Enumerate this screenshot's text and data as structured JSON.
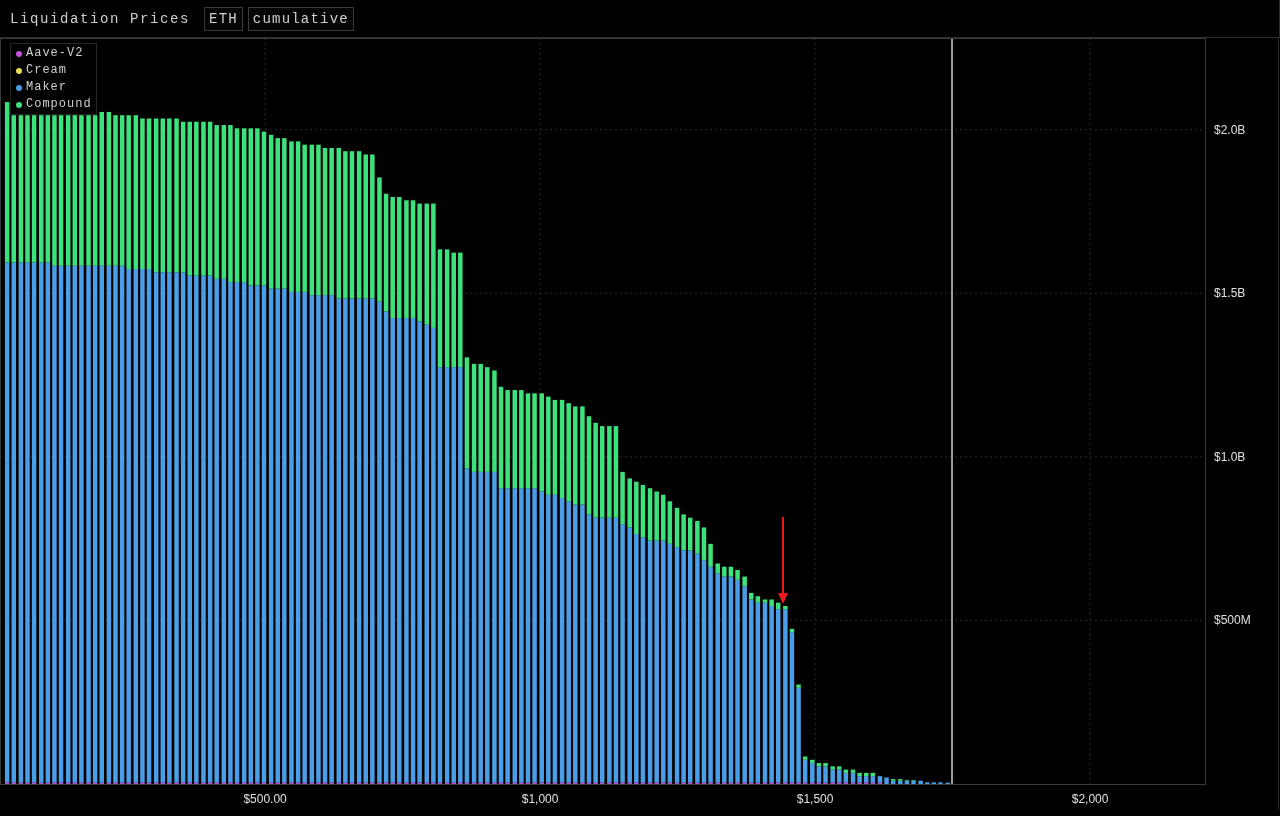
{
  "header": {
    "title": "Liquidation Prices",
    "buttons": [
      {
        "label": "ETH"
      },
      {
        "label": "cumulative"
      }
    ]
  },
  "chart": {
    "chart_data": {
      "type": "bar",
      "stacked": true,
      "x": [
        31,
        43,
        56,
        68,
        80,
        93,
        105,
        117,
        129,
        142,
        154,
        166,
        179,
        191,
        203,
        216,
        228,
        240,
        252,
        265,
        277,
        289,
        302,
        314,
        326,
        339,
        351,
        363,
        375,
        388,
        400,
        412,
        425,
        437,
        449,
        462,
        474,
        486,
        498,
        511,
        523,
        535,
        548,
        560,
        572,
        585,
        597,
        609,
        621,
        634,
        646,
        658,
        671,
        683,
        695,
        708,
        720,
        732,
        744,
        757,
        769,
        781,
        794,
        806,
        818,
        831,
        843,
        855,
        867,
        880,
        892,
        904,
        917,
        929,
        941,
        954,
        966,
        978,
        990,
        1003,
        1015,
        1027,
        1040,
        1052,
        1064,
        1077,
        1089,
        1101,
        1113,
        1126,
        1138,
        1150,
        1163,
        1175,
        1187,
        1200,
        1212,
        1224,
        1236,
        1249,
        1261,
        1273,
        1286,
        1298,
        1310,
        1323,
        1335,
        1347,
        1359,
        1372,
        1384,
        1396,
        1409,
        1421,
        1433,
        1446,
        1458,
        1470,
        1482,
        1495,
        1507,
        1519,
        1532,
        1544,
        1556,
        1569,
        1581,
        1593,
        1605,
        1618,
        1630,
        1642,
        1655,
        1667,
        1679,
        1692,
        1704,
        1716,
        1728,
        1741
      ],
      "series": [
        {
          "name": "Aave-V2",
          "color": "#c64fd8",
          "values": [
            4000000.0,
            4000000.0,
            4000000.0,
            4000000.0,
            4000000.0,
            4000000.0,
            4000000.0,
            4000000.0,
            4000000.0,
            4000000.0,
            4000000.0,
            4000000.0,
            4000000.0,
            4000000.0,
            4000000.0,
            4000000.0,
            4000000.0,
            4000000.0,
            4000000.0,
            4000000.0,
            4000000.0,
            4000000.0,
            4000000.0,
            4000000.0,
            4000000.0,
            4000000.0,
            4000000.0,
            4000000.0,
            4000000.0,
            4000000.0,
            4000000.0,
            4000000.0,
            4000000.0,
            4000000.0,
            4000000.0,
            4000000.0,
            4000000.0,
            4000000.0,
            4000000.0,
            4000000.0,
            4000000.0,
            4000000.0,
            4000000.0,
            4000000.0,
            4000000.0,
            4000000.0,
            4000000.0,
            4000000.0,
            4000000.0,
            4000000.0,
            4000000.0,
            4000000.0,
            4000000.0,
            4000000.0,
            4000000.0,
            4000000.0,
            4000000.0,
            4000000.0,
            4000000.0,
            4000000.0,
            4000000.0,
            4000000.0,
            4000000.0,
            4000000.0,
            4000000.0,
            4000000.0,
            4000000.0,
            4000000.0,
            4000000.0,
            4000000.0,
            4000000.0,
            4000000.0,
            4000000.0,
            4000000.0,
            4000000.0,
            4000000.0,
            4000000.0,
            4000000.0,
            4000000.0,
            4000000.0,
            4000000.0,
            4000000.0,
            4000000.0,
            4000000.0,
            4000000.0,
            4000000.0,
            4000000.0,
            4000000.0,
            4000000.0,
            4000000.0,
            4000000.0,
            4000000.0,
            4000000.0,
            4000000.0,
            4000000.0,
            4000000.0,
            4000000.0,
            4000000.0,
            4000000.0,
            4000000.0,
            4000000.0,
            4000000.0,
            4000000.0,
            4000000.0,
            4000000.0,
            4000000.0,
            4000000.0,
            4000000.0,
            4000000.0,
            4000000.0,
            4000000.0,
            4000000.0,
            4000000.0,
            4000000.0,
            4000000.0,
            4000000.0,
            4000000.0,
            4000000.0,
            4000000.0,
            4000000.0,
            4000000.0,
            4000000.0,
            4000000.0,
            4000000.0,
            4000000.0,
            4000000.0,
            4000000.0,
            4000000.0,
            4000000.0,
            4000000.0,
            0,
            0,
            0,
            0,
            0,
            0,
            0,
            0,
            0,
            0
          ]
        },
        {
          "name": "Cream",
          "color": "#e6e05a",
          "values": [
            0,
            0,
            0,
            0,
            0,
            0,
            0,
            0,
            0,
            0,
            0,
            0,
            0,
            0,
            0,
            0,
            0,
            0,
            0,
            0,
            0,
            0,
            0,
            0,
            0,
            0,
            0,
            0,
            0,
            0,
            0,
            0,
            0,
            0,
            0,
            0,
            0,
            0,
            0,
            0,
            0,
            0,
            0,
            0,
            0,
            0,
            0,
            0,
            0,
            0,
            0,
            0,
            0,
            0,
            0,
            0,
            0,
            0,
            0,
            0,
            0,
            0,
            0,
            0,
            0,
            0,
            0,
            0,
            0,
            0,
            0,
            0,
            0,
            0,
            0,
            0,
            0,
            0,
            0,
            0,
            0,
            0,
            0,
            0,
            0,
            0,
            0,
            0,
            0,
            0,
            0,
            0,
            0,
            0,
            0,
            0,
            0,
            0,
            0,
            0,
            0,
            0,
            0,
            0,
            0,
            0,
            0,
            0,
            0,
            0,
            0,
            0,
            0,
            0,
            0,
            0,
            0,
            0,
            0,
            0,
            0,
            0,
            0,
            0,
            0,
            0,
            0,
            0,
            0,
            0,
            0,
            0,
            0,
            0,
            0,
            0,
            0,
            0,
            0,
            0
          ]
        },
        {
          "name": "Maker",
          "color": "#4a9de6",
          "values": [
            1590000000.0,
            1590000000.0,
            1590000000.0,
            1590000000.0,
            1590000000.0,
            1590000000.0,
            1590000000.0,
            1580000000.0,
            1580000000.0,
            1580000000.0,
            1580000000.0,
            1580000000.0,
            1580000000.0,
            1580000000.0,
            1580000000.0,
            1580000000.0,
            1580000000.0,
            1580000000.0,
            1570000000.0,
            1570000000.0,
            1570000000.0,
            1570000000.0,
            1560000000.0,
            1560000000.0,
            1560000000.0,
            1560000000.0,
            1560000000.0,
            1550000000.0,
            1550000000.0,
            1550000000.0,
            1550000000.0,
            1540000000.0,
            1540000000.0,
            1530000000.0,
            1530000000.0,
            1530000000.0,
            1520000000.0,
            1520000000.0,
            1520000000.0,
            1510000000.0,
            1510000000.0,
            1510000000.0,
            1500000000.0,
            1500000000.0,
            1500000000.0,
            1490000000.0,
            1490000000.0,
            1490000000.0,
            1490000000.0,
            1480000000.0,
            1480000000.0,
            1480000000.0,
            1480000000.0,
            1480000000.0,
            1480000000.0,
            1470000000.0,
            1440000000.0,
            1420000000.0,
            1420000000.0,
            1420000000.0,
            1420000000.0,
            1410000000.0,
            1400000000.0,
            1390000000.0,
            1270000000.0,
            1270000000.0,
            1270000000.0,
            1270000000.0,
            960000000.0,
            950000000.0,
            950000000.0,
            950000000.0,
            950000000.0,
            900000000.0,
            900000000.0,
            900000000.0,
            900000000.0,
            900000000.0,
            900000000.0,
            890000000.0,
            880000000.0,
            880000000.0,
            870000000.0,
            860000000.0,
            850000000.0,
            850000000.0,
            820000000.0,
            810000000.0,
            810000000.0,
            810000000.0,
            810000000.0,
            790000000.0,
            780000000.0,
            760000000.0,
            750000000.0,
            740000000.0,
            740000000.0,
            740000000.0,
            730000000.0,
            720000000.0,
            710000000.0,
            710000000.0,
            700000000.0,
            680000000.0,
            660000000.0,
            640000000.0,
            630000000.0,
            630000000.0,
            620000000.0,
            600000000.0,
            560000000.0,
            550000000.0,
            550000000.0,
            540000000.0,
            530000000.0,
            530000000.0,
            460000000.0,
            290000000.0,
            70000000.0,
            60000000.0,
            50000000.0,
            50000000.0,
            40000000.0,
            40000000.0,
            30000000.0,
            30000000.0,
            20000000.0,
            20000000.0,
            20000000.0,
            20000000.0,
            20000000.0,
            10000000.0,
            10000000.0,
            10000000.0,
            10000000.0,
            10000000.0,
            5000000.0,
            5000000.0,
            5000000.0,
            4000000.0
          ]
        },
        {
          "name": "Compound",
          "color": "#3ee27c",
          "values": [
            490000000.0,
            450000000.0,
            450000000.0,
            450000000.0,
            450000000.0,
            450000000.0,
            450000000.0,
            460000000.0,
            460000000.0,
            460000000.0,
            460000000.0,
            460000000.0,
            460000000.0,
            460000000.0,
            470000000.0,
            470000000.0,
            460000000.0,
            460000000.0,
            470000000.0,
            470000000.0,
            460000000.0,
            460000000.0,
            470000000.0,
            470000000.0,
            470000000.0,
            470000000.0,
            460000000.0,
            470000000.0,
            470000000.0,
            470000000.0,
            470000000.0,
            470000000.0,
            470000000.0,
            480000000.0,
            470000000.0,
            470000000.0,
            480000000.0,
            480000000.0,
            470000000.0,
            470000000.0,
            460000000.0,
            460000000.0,
            460000000.0,
            460000000.0,
            450000000.0,
            460000000.0,
            460000000.0,
            450000000.0,
            450000000.0,
            460000000.0,
            450000000.0,
            450000000.0,
            450000000.0,
            440000000.0,
            440000000.0,
            380000000.0,
            360000000.0,
            370000000.0,
            370000000.0,
            360000000.0,
            360000000.0,
            360000000.0,
            370000000.0,
            380000000.0,
            360000000.0,
            360000000.0,
            350000000.0,
            350000000.0,
            340000000.0,
            330000000.0,
            330000000.0,
            320000000.0,
            310000000.0,
            310000000.0,
            300000000.0,
            300000000.0,
            300000000.0,
            290000000.0,
            290000000.0,
            300000000.0,
            300000000.0,
            290000000.0,
            300000000.0,
            300000000.0,
            300000000.0,
            300000000.0,
            300000000.0,
            290000000.0,
            280000000.0,
            280000000.0,
            280000000.0,
            160000000.0,
            150000000.0,
            160000000.0,
            160000000.0,
            160000000.0,
            150000000.0,
            140000000.0,
            130000000.0,
            120000000.0,
            110000000.0,
            100000000.0,
            100000000.0,
            100000000.0,
            70000000.0,
            30000000.0,
            30000000.0,
            30000000.0,
            30000000.0,
            30000000.0,
            20000000.0,
            20000000.0,
            10000000.0,
            20000000.0,
            20000000.0,
            10000000.0,
            10000000.0,
            10000000.0,
            10000000.0,
            10000000.0,
            10000000.0,
            10000000.0,
            10000000.0,
            10000000.0,
            10000000.0,
            10000000.0,
            10000000.0,
            10000000.0,
            10000000.0,
            0,
            0,
            5000000.0,
            5000000.0,
            2000000.0,
            2000000.0,
            0,
            0,
            0,
            0,
            0
          ]
        }
      ],
      "xlim": [
        18,
        2209
      ],
      "ylim": [
        0,
        2280000000.0
      ],
      "xticks": [
        {
          "value": 500,
          "label": "$500.00"
        },
        {
          "value": 1000,
          "label": "$1,000"
        },
        {
          "value": 1500,
          "label": "$1,500"
        },
        {
          "value": 2000,
          "label": "$2,000"
        }
      ],
      "yticks": [
        {
          "value": 500000000.0,
          "label": "$500M"
        },
        {
          "value": 1000000000.0,
          "label": "$1.0B"
        },
        {
          "value": 1500000000.0,
          "label": "$1.5B"
        },
        {
          "value": 2000000000.0,
          "label": "$2.0B"
        }
      ],
      "grid": true,
      "ref_lines": [
        {
          "axis": "x",
          "value": 1749
        }
      ]
    }
  }
}
